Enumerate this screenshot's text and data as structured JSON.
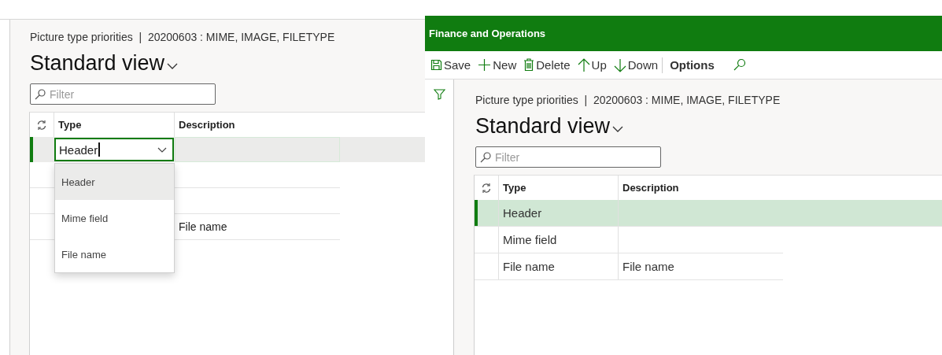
{
  "left_panel": {
    "breadcrumb": "Picture type priorities  |  20200603 : MIME, IMAGE, FILETYPE",
    "view_title": "Standard view",
    "filter": {
      "placeholder": "Filter"
    },
    "grid": {
      "columns": [
        "Type",
        "Description"
      ],
      "rows": [
        {
          "selected": true
        },
        {
          "selected": false
        },
        {
          "selected": false
        },
        {
          "description": "File name",
          "selected": false
        }
      ]
    },
    "editor": {
      "value": "Header"
    },
    "dropdown": {
      "items": [
        {
          "label": "Header",
          "selected": true
        },
        {
          "label": "Mime field",
          "selected": false
        },
        {
          "label": "File name",
          "selected": false
        }
      ]
    }
  },
  "right_panel": {
    "app_title": "Finance and Operations",
    "toolbar": [
      {
        "label": "Save",
        "kind": "command"
      },
      {
        "label": "New",
        "kind": "command"
      },
      {
        "label": "Delete",
        "kind": "command"
      },
      {
        "label": "Up",
        "kind": "command"
      },
      {
        "label": "Down",
        "kind": "command"
      },
      {
        "label": "Options",
        "kind": "menu"
      }
    ],
    "breadcrumb": "Picture type priorities  |  20200603 : MIME, IMAGE, FILETYPE",
    "view_title": "Standard view",
    "filter": {
      "placeholder": "Filter"
    },
    "grid": {
      "columns": [
        "Type",
        "Description"
      ],
      "rows": [
        {
          "type": "Header",
          "selected": true
        },
        {
          "type": "Mime field",
          "selected": false
        },
        {
          "type": "File name",
          "description": "File name",
          "selected": false
        }
      ]
    }
  }
}
